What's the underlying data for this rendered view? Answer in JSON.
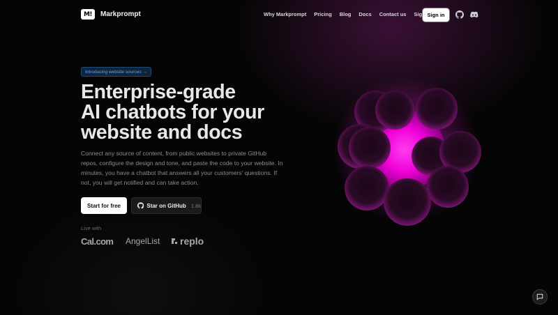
{
  "brand": {
    "mark": "M!",
    "name": "Markprompt"
  },
  "nav": {
    "links": [
      "Why Markprompt",
      "Pricing",
      "Blog",
      "Docs",
      "Contact us",
      "Sign up"
    ],
    "signin_label": "Sign in",
    "icons": [
      "github-icon",
      "discord-icon"
    ]
  },
  "hero": {
    "badge": "Introducing website sources →",
    "headline_lines": [
      "Enterprise-grade",
      "AI chatbots for your",
      "website and docs"
    ],
    "subtext": "Connect any source of content, from public websites to private GitHub repos, configure the design and tone, and paste the code to your website. In minutes, you have a chatbot that answers all your customers' questions. If not, you will get notified and can take action.",
    "primary_cta": "Start for free",
    "github_cta": "Star on GitHub",
    "github_count": "1.8k",
    "live_with": "Live with",
    "customers": [
      "Cal.com",
      "AngelList",
      "replo"
    ]
  },
  "colors": {
    "background": "#050505",
    "accent_magenta": "#ff1ee6",
    "badge_text": "#5aa8ff",
    "badge_bg": "#10243a"
  },
  "chat": {
    "icon": "chat-bubble-icon"
  }
}
